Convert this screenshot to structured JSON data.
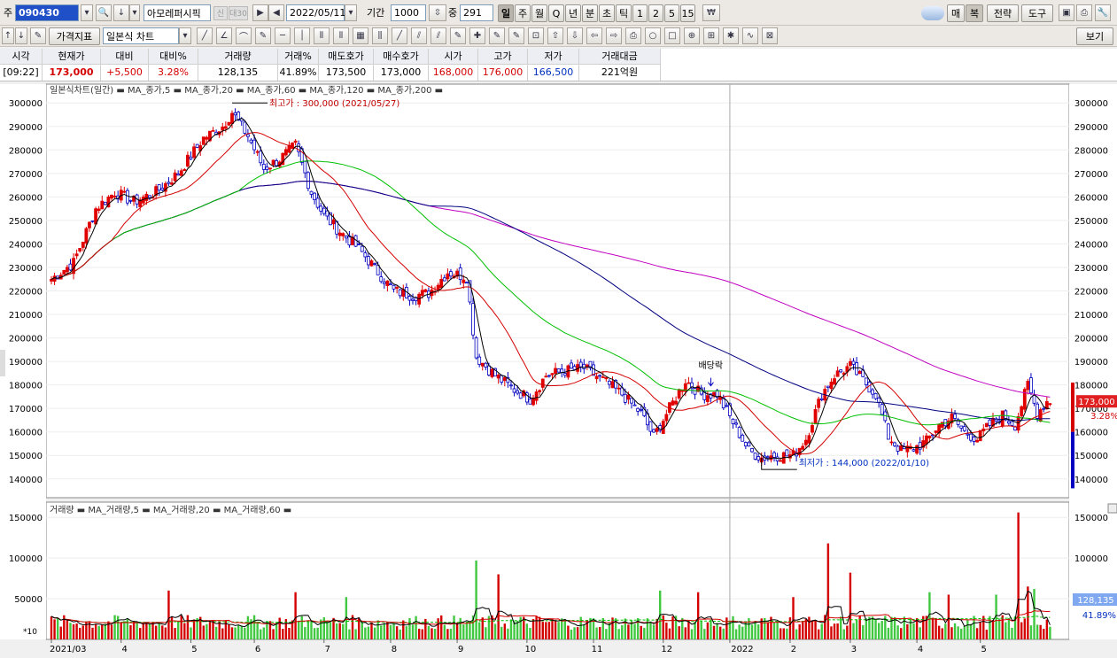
{
  "toolbar": {
    "type_label": "주",
    "code": "090430",
    "name": "아모레퍼시픽",
    "badge1": "신",
    "badge2": "대30",
    "date": "2022/05/11",
    "period_label": "기간",
    "period": "1000",
    "middle_label": "중",
    "middle": "291",
    "periods": [
      "일",
      "주",
      "월",
      "Q",
      "년",
      "분",
      "초",
      "틱",
      "1",
      "2",
      "5",
      "15"
    ],
    "right_buttons": [
      "매",
      "복",
      "전략",
      "도구",
      "보기"
    ],
    "chart_kind_btn": "가격지표",
    "chart_type": "일본식 차트"
  },
  "quote": {
    "headers": [
      "시각",
      "현재가",
      "대비",
      "대비%",
      "거래량",
      "거래%",
      "매도호가",
      "매수호가",
      "시가",
      "고가",
      "저가",
      "거래대금"
    ],
    "values": [
      "[09:22]",
      "173,000",
      "+5,500",
      "3.28%",
      "128,135",
      "41.89%",
      "173,500",
      "173,000",
      "168,000",
      "176,000",
      "166,500",
      "221억원"
    ]
  },
  "chart_data": [
    {
      "type": "candlestick",
      "legend": "일본식차트(일간) ▬ MA_종가,5 ▬ MA_종가,20 ▬ MA_종가,60 ▬ MA_종가,120 ▬ MA_종가,200 ▬",
      "ma_colors": {
        "ma5": "#000000",
        "ma20": "#d40000",
        "ma60": "#00c000",
        "ma120": "#000080",
        "ma200": "#c000c0"
      },
      "ylim": [
        132000,
        308000
      ],
      "yticks": [
        140000,
        150000,
        160000,
        170000,
        180000,
        190000,
        200000,
        210000,
        220000,
        230000,
        240000,
        250000,
        260000,
        270000,
        280000,
        290000,
        300000
      ],
      "x_months": [
        "2021/03",
        "4",
        "5",
        "6",
        "7",
        "8",
        "9",
        "10",
        "11",
        "12",
        "2022",
        "2",
        "3",
        "4",
        "5"
      ],
      "anchors": [
        [
          0,
          225000
        ],
        [
          7,
          232000
        ],
        [
          14,
          255000
        ],
        [
          20,
          262000
        ],
        [
          26,
          258000
        ],
        [
          33,
          262000
        ],
        [
          40,
          270000
        ],
        [
          48,
          285000
        ],
        [
          54,
          290000
        ],
        [
          57,
          296000
        ],
        [
          62,
          286000
        ],
        [
          67,
          272000
        ],
        [
          72,
          276000
        ],
        [
          77,
          282000
        ],
        [
          82,
          262000
        ],
        [
          86,
          252000
        ],
        [
          92,
          244000
        ],
        [
          97,
          238000
        ],
        [
          103,
          228000
        ],
        [
          108,
          220000
        ],
        [
          114,
          218000
        ],
        [
          119,
          219000
        ],
        [
          125,
          228000
        ],
        [
          131,
          226000
        ],
        [
          134,
          192000
        ],
        [
          140,
          184000
        ],
        [
          146,
          178000
        ],
        [
          151,
          174000
        ],
        [
          156,
          184000
        ],
        [
          162,
          186000
        ],
        [
          168,
          187000
        ],
        [
          174,
          182000
        ],
        [
          180,
          176000
        ],
        [
          186,
          168000
        ],
        [
          190,
          158000
        ],
        [
          195,
          170000
        ],
        [
          200,
          182000
        ],
        [
          205,
          176000
        ],
        [
          210,
          176000
        ],
        [
          215,
          164000
        ],
        [
          220,
          152000
        ],
        [
          224,
          149000
        ],
        [
          228,
          150000
        ],
        [
          234,
          150000
        ],
        [
          238,
          157000
        ],
        [
          243,
          176000
        ],
        [
          247,
          184000
        ],
        [
          252,
          188000
        ],
        [
          256,
          182000
        ],
        [
          260,
          176000
        ],
        [
          264,
          158000
        ],
        [
          268,
          152000
        ],
        [
          272,
          153000
        ],
        [
          276,
          156000
        ],
        [
          280,
          163000
        ],
        [
          284,
          166000
        ],
        [
          288,
          160000
        ],
        [
          292,
          157000
        ],
        [
          296,
          163000
        ],
        [
          300,
          167000
        ],
        [
          304,
          163000
        ],
        [
          308,
          180000
        ],
        [
          311,
          168000
        ],
        [
          314,
          173000
        ]
      ],
      "current_price": "173,000",
      "current_pct": "3.28%",
      "high_label": "최고가 : 300,000 (2021/05/27)",
      "low_label": "최저가 : 144,000 (2022/01/10)",
      "event_label": "배당락"
    },
    {
      "type": "bar",
      "legend": "거래량 ▬ MA_거래량,5 ▬ MA_거래량,20 ▬ MA_거래량,60 ▬",
      "ylim": [
        0,
        160000
      ],
      "yticks": [
        50000,
        100000,
        150000
      ],
      "spikes": [
        [
          37,
          60000
        ],
        [
          77,
          58000
        ],
        [
          93,
          52000
        ],
        [
          134,
          97000
        ],
        [
          141,
          80000
        ],
        [
          192,
          60000
        ],
        [
          204,
          58000
        ],
        [
          234,
          52000
        ],
        [
          245,
          118000
        ],
        [
          252,
          82000
        ],
        [
          277,
          58000
        ],
        [
          283,
          55000
        ],
        [
          298,
          55000
        ],
        [
          305,
          156000
        ],
        [
          308,
          65000
        ],
        [
          310,
          62000
        ]
      ],
      "current_volume": "128,135",
      "current_pct": "41.89%",
      "multiplier": "*10"
    }
  ]
}
